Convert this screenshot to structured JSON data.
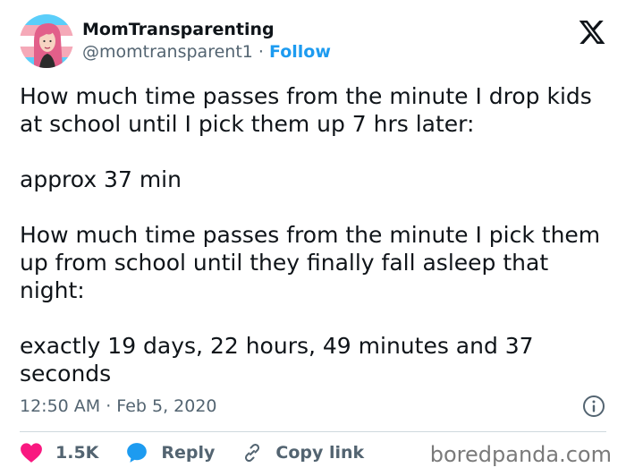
{
  "user": {
    "display_name": "MomTransparenting",
    "handle": "@momtransparent1",
    "separator": "·",
    "follow_label": "Follow"
  },
  "tweet": {
    "paragraphs": [
      "How much time passes from the minute I drop kids at school until I pick them up 7 hrs later:",
      "approx 37 min",
      "How much time passes from the minute I pick them up from school until they finally fall asleep that night:",
      "exactly 19 days, 22 hours, 49 minutes and 37 seconds"
    ],
    "timestamp": "12:50 AM · Feb 5, 2020"
  },
  "actions": {
    "likes_count": "1.5K",
    "reply_label": "Reply",
    "copy_link_label": "Copy link"
  },
  "icons": {
    "platform_logo": "x-logo-icon",
    "info": "info-icon",
    "like": "heart-icon",
    "reply": "speech-bubble-icon",
    "copy_link": "link-icon"
  },
  "colors": {
    "follow_blue": "#1d9bf0",
    "heart_pink": "#f91880",
    "reply_blue": "#1d9bf0",
    "text_primary": "#0f1419",
    "text_secondary": "#536471"
  },
  "watermark": "boredpanda.com"
}
